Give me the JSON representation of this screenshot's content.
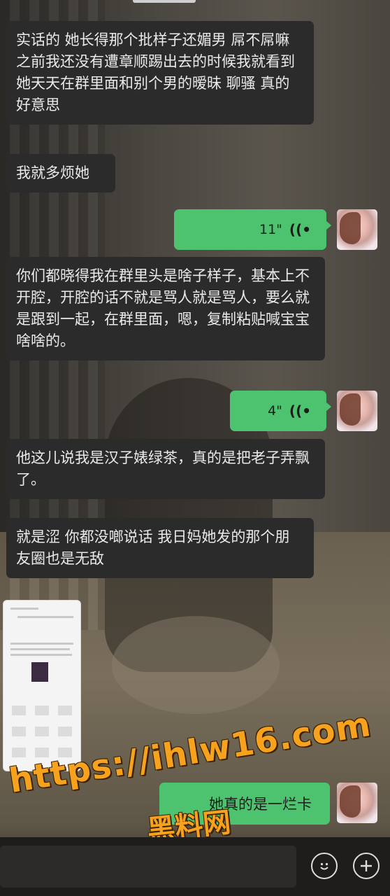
{
  "messages": [
    {
      "type": "incoming",
      "text": "实话的 她长得那个批样子还媚男 屌不屌嘛 之前我还没有遭章顺踢出去的时候我就看到她天天在群里面和别个男的暧昧 聊骚 真的好意思"
    },
    {
      "type": "incoming",
      "text": "我就多烦她"
    },
    {
      "type": "outgoing-voice",
      "duration": "11\""
    },
    {
      "type": "incoming",
      "text": "你们都晓得我在群里头是啥子样子，基本上不开腔，开腔的话不就是骂人就是骂人，要么就是跟到一起，在群里面，嗯，复制粘贴喊宝宝啥啥的。"
    },
    {
      "type": "outgoing-voice",
      "duration": "4\""
    },
    {
      "type": "incoming",
      "text": "他这儿说我是汉子婊绿茶，真的是把老子弄飘了。"
    },
    {
      "type": "incoming",
      "text": "就是涩 你都没啷说话 我日妈她发的那个朋友圈也是无敌"
    },
    {
      "type": "incoming-image",
      "icon": "screenshot-thumbnail"
    },
    {
      "type": "outgoing",
      "text": "她真的是一烂卡"
    }
  ],
  "watermark": {
    "url": "https://ihlw16.com",
    "name": "黑料网"
  },
  "bottom_bar": {
    "emoji_icon": "smile-icon",
    "plus_icon": "plus-icon"
  },
  "colors": {
    "incoming_bubble": "#2b2b2b",
    "outgoing_bubble": "#4ec36f",
    "watermark": "#f6a21e"
  }
}
